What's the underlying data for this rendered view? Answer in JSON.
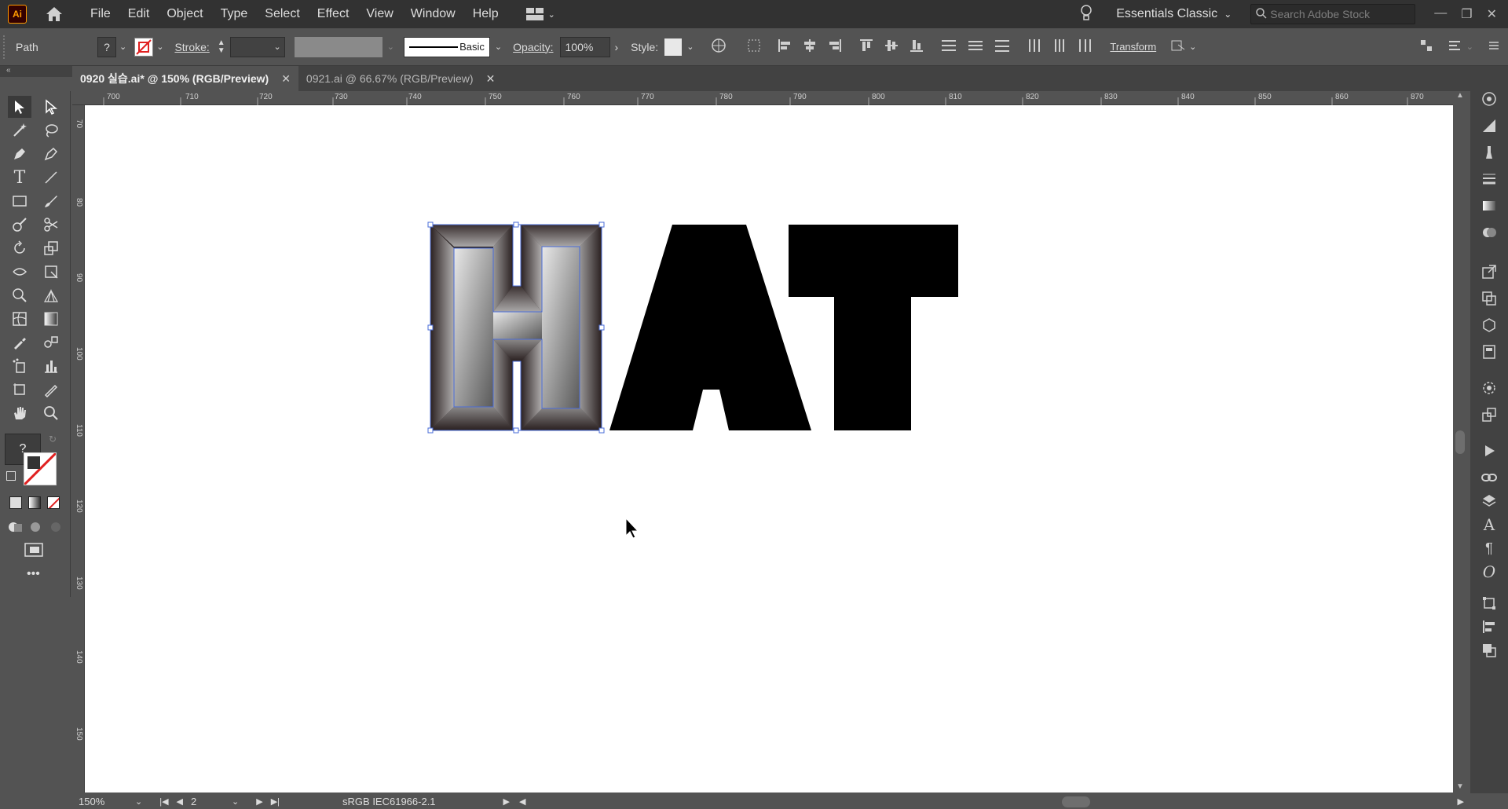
{
  "app": {
    "logo_text": "Ai",
    "menu": [
      "File",
      "Edit",
      "Object",
      "Type",
      "Select",
      "Effect",
      "View",
      "Window",
      "Help"
    ],
    "workspace": "Essentials Classic",
    "search_placeholder": "Search Adobe Stock"
  },
  "control_bar": {
    "selection_type": "Path",
    "fill_label": "?",
    "stroke_label": "Stroke:",
    "brush_style": "Basic",
    "opacity_label": "Opacity:",
    "opacity_value": "100%",
    "style_label": "Style:",
    "transform_label": "Transform"
  },
  "tabs": [
    {
      "title": "0920 실습.ai* @ 150% (RGB/Preview)",
      "active": true
    },
    {
      "title": "0921.ai @ 66.67% (RGB/Preview)",
      "active": false
    }
  ],
  "ruler": {
    "h_ticks": [
      "700",
      "710",
      "720",
      "730",
      "740",
      "750",
      "760",
      "770",
      "780",
      "790",
      "800",
      "810",
      "820",
      "830",
      "840",
      "850",
      "860",
      "870"
    ],
    "v_ticks": [
      "70",
      "80",
      "90",
      "100",
      "110",
      "120",
      "130",
      "140",
      "150"
    ]
  },
  "canvas": {
    "letters": [
      "H",
      "A",
      "T"
    ],
    "selected_letter": "H",
    "fill_colors": {
      "artwork": "#000000",
      "gradient_light": "#e8e8e8",
      "gradient_dark": "#2a2020",
      "selection": "#4a6cd8"
    }
  },
  "status_bar": {
    "zoom": "150%",
    "artboard_number": "2",
    "color_profile": "sRGB IEC61966-2.1"
  },
  "tool_panel": {
    "fill_stroke_unknown": "?"
  }
}
